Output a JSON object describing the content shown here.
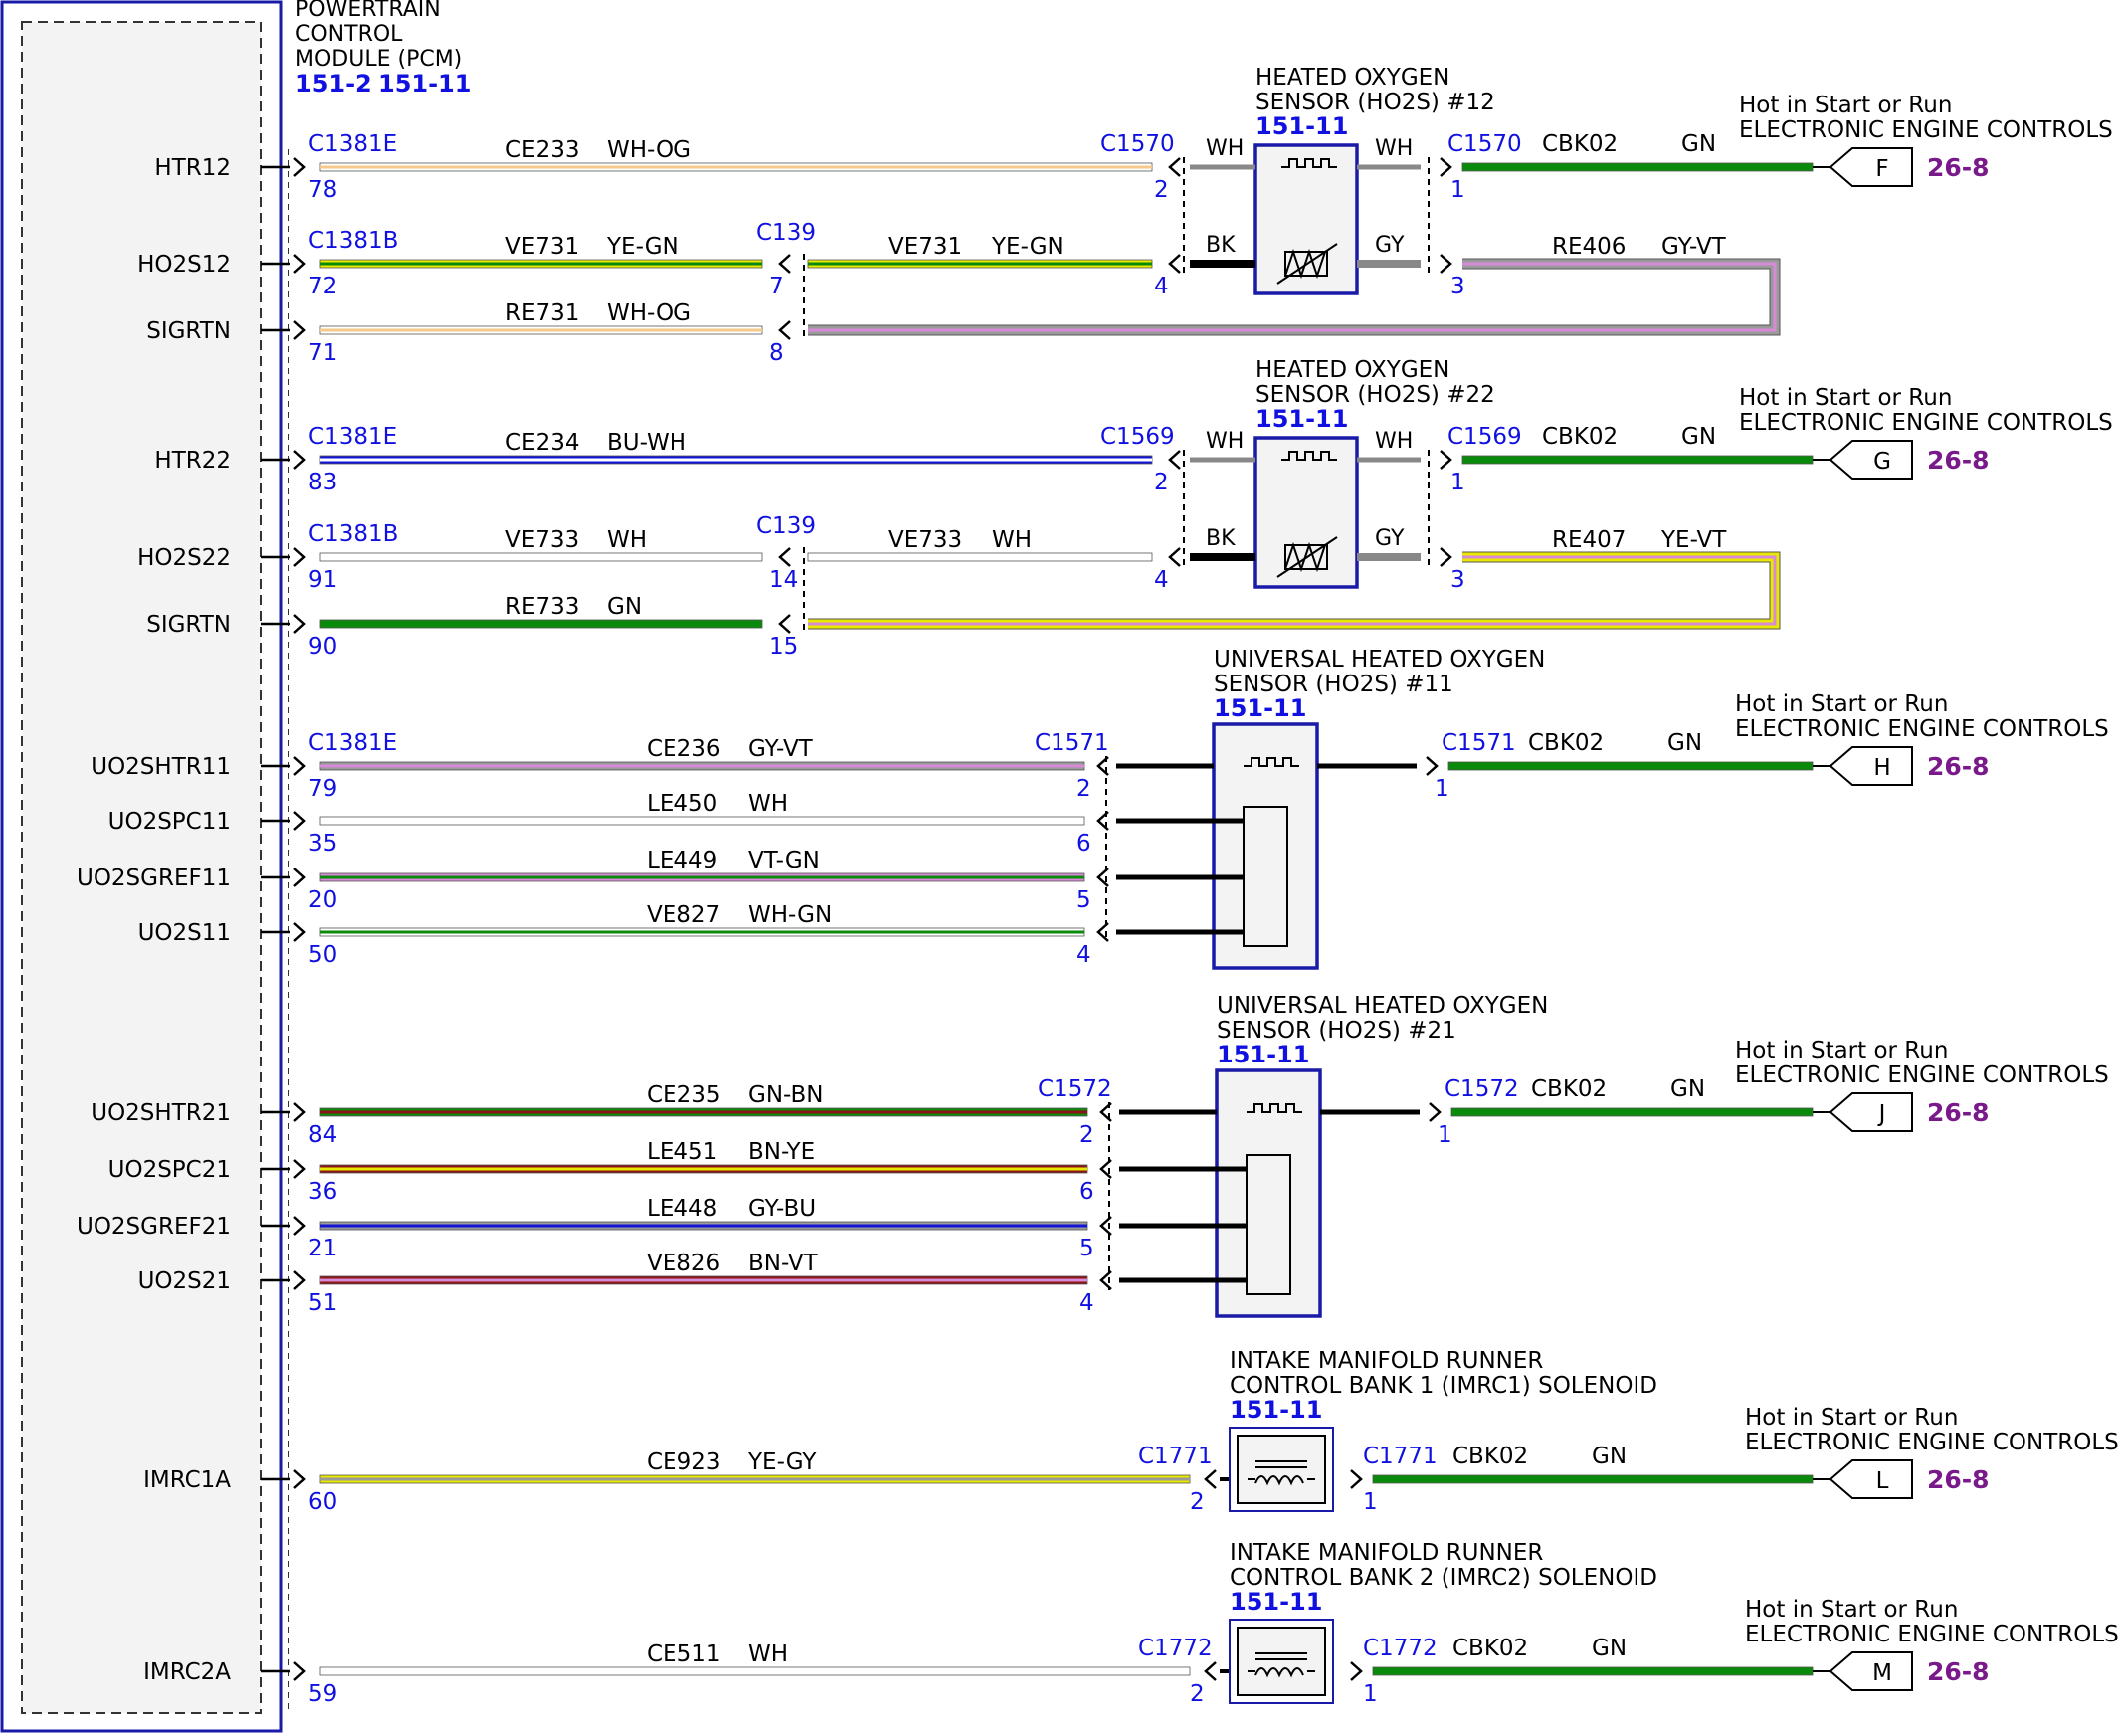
{
  "module": {
    "title_lines": [
      "POWERTRAIN",
      "CONTROL",
      "MODULE (PCM)"
    ],
    "refs": [
      "151-2",
      "151-11"
    ]
  },
  "colors": {
    "link_blue": "#1010e0",
    "ref_purple": "#7a1a8a",
    "module_border": "#1a1aa8",
    "box_fill": "#f3f3f3",
    "WH": "#ffffff",
    "OG": "#f4c98a",
    "YE": "#e8e800",
    "GN": "#0a8a0a",
    "DKGN": "#2e6e10",
    "BU": "#1414d8",
    "GY": "#9a9a9a",
    "VT": "#d88ad8",
    "BN": "#8a1414",
    "BK": "#000000"
  },
  "circuits": [
    {
      "pin_name": "HTR12",
      "pcm_connector": "C1381E",
      "pcm_pin": "78",
      "circuit": "CE233",
      "color_code": "WH-OG"
    },
    {
      "pin_name": "HO2S12",
      "pcm_connector": "C1381B",
      "pcm_pin": "72",
      "circuit": "VE731",
      "color_code": "YE-GN",
      "mid_connector": "C139",
      "mid_pin": "7",
      "circuit_b": "VE731",
      "color_code_b": "YE-GN"
    },
    {
      "pin_name": "SIGRTN",
      "pcm_pin": "71",
      "circuit": "RE731",
      "color_code": "WH-OG",
      "mid_pin": "8"
    },
    {
      "pin_name": "HTR22",
      "pcm_connector": "C1381E",
      "pcm_pin": "83",
      "circuit": "CE234",
      "color_code": "BU-WH"
    },
    {
      "pin_name": "HO2S22",
      "pcm_connector": "C1381B",
      "pcm_pin": "91",
      "circuit": "VE733",
      "color_code": "WH",
      "mid_connector": "C139",
      "mid_pin": "14",
      "circuit_b": "VE733",
      "color_code_b": "WH"
    },
    {
      "pin_name": "SIGRTN",
      "pcm_pin": "90",
      "circuit": "RE733",
      "color_code": "GN",
      "mid_pin": "15"
    },
    {
      "pin_name": "UO2SHTR11",
      "pcm_connector": "C1381E",
      "pcm_pin": "79",
      "circuit": "CE236",
      "color_code": "GY-VT"
    },
    {
      "pin_name": "UO2SPC11",
      "pcm_pin": "35",
      "circuit": "LE450",
      "color_code": "WH"
    },
    {
      "pin_name": "UO2SGREF11",
      "pcm_pin": "20",
      "circuit": "LE449",
      "color_code": "VT-GN"
    },
    {
      "pin_name": "UO2S11",
      "pcm_pin": "50",
      "circuit": "VE827",
      "color_code": "WH-GN"
    },
    {
      "pin_name": "UO2SHTR21",
      "pcm_pin": "84",
      "circuit": "CE235",
      "color_code": "GN-BN"
    },
    {
      "pin_name": "UO2SPC21",
      "pcm_pin": "36",
      "circuit": "LE451",
      "color_code": "BN-YE"
    },
    {
      "pin_name": "UO2SGREF21",
      "pcm_pin": "21",
      "circuit": "LE448",
      "color_code": "GY-BU"
    },
    {
      "pin_name": "UO2S21",
      "pcm_pin": "51",
      "circuit": "VE826",
      "color_code": "BN-VT"
    },
    {
      "pin_name": "IMRC1A",
      "pcm_pin": "60",
      "circuit": "CE923",
      "color_code": "YE-GY"
    },
    {
      "pin_name": "IMRC2A",
      "pcm_pin": "59",
      "circuit": "CE511",
      "color_code": "WH"
    }
  ],
  "sensor_connectors": [
    "C1570",
    "C1569",
    "C1571",
    "C1572",
    "C1771",
    "C1772"
  ],
  "sensor_pins": [
    "2",
    "4",
    "1",
    "3",
    "2",
    "6",
    "5",
    "4",
    "1",
    "2",
    "1"
  ],
  "sensors": [
    {
      "name_lines": [
        "HEATED OXYGEN",
        "SENSOR (HO2S) #12"
      ],
      "ref": "151-11",
      "left_wire_top": "WH",
      "left_wire_bottom": "BK",
      "right_wire_top": "WH",
      "right_wire_bottom": "GY"
    },
    {
      "name_lines": [
        "HEATED OXYGEN",
        "SENSOR (HO2S) #22"
      ],
      "ref": "151-11",
      "left_wire_top": "WH",
      "left_wire_bottom": "BK",
      "right_wire_top": "WH",
      "right_wire_bottom": "GY"
    },
    {
      "name_lines": [
        "UNIVERSAL HEATED OXYGEN",
        "SENSOR (HO2S) #11"
      ],
      "ref": "151-11"
    },
    {
      "name_lines": [
        "UNIVERSAL HEATED OXYGEN",
        "SENSOR (HO2S) #21"
      ],
      "ref": "151-11"
    },
    {
      "name_lines": [
        "INTAKE MANIFOLD RUNNER",
        "CONTROL BANK 1 (IMRC1) SOLENOID"
      ],
      "ref": "151-11"
    },
    {
      "name_lines": [
        "INTAKE MANIFOLD RUNNER",
        "CONTROL BANK 2 (IMRC2) SOLENOID"
      ],
      "ref": "151-11"
    }
  ],
  "return_wires": [
    {
      "circuit": "RE406",
      "color_code": "GY-VT"
    },
    {
      "circuit": "RE407",
      "color_code": "YE-VT"
    }
  ],
  "power_feeds": [
    {
      "circuit": "CBK02",
      "color_code": "GN",
      "label_top": "Hot in Start or Run",
      "label_bottom": "ELECTRONIC ENGINE CONTROLS",
      "letter": "F",
      "ref": "26-8"
    },
    {
      "circuit": "CBK02",
      "color_code": "GN",
      "label_top": "Hot in Start or Run",
      "label_bottom": "ELECTRONIC ENGINE CONTROLS",
      "letter": "G",
      "ref": "26-8"
    },
    {
      "circuit": "CBK02",
      "color_code": "GN",
      "label_top": "Hot in Start or Run",
      "label_bottom": "ELECTRONIC ENGINE CONTROLS",
      "letter": "H",
      "ref": "26-8"
    },
    {
      "circuit": "CBK02",
      "color_code": "GN",
      "label_top": "Hot in Start or Run",
      "label_bottom": "ELECTRONIC ENGINE CONTROLS",
      "letter": "J",
      "ref": "26-8"
    },
    {
      "circuit": "CBK02",
      "color_code": "GN",
      "label_top": "Hot in Start or Run",
      "label_bottom": "ELECTRONIC ENGINE CONTROLS",
      "letter": "L",
      "ref": "26-8"
    },
    {
      "circuit": "CBK02",
      "color_code": "GN",
      "label_top": "Hot in Start or Run",
      "label_bottom": "ELECTRONIC ENGINE CONTROLS",
      "letter": "M",
      "ref": "26-8"
    }
  ]
}
